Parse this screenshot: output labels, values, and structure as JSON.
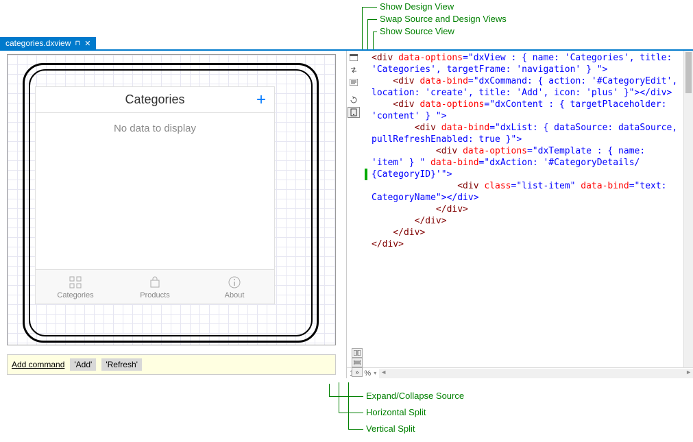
{
  "annotations": {
    "showDesign": "Show Design View",
    "swap": "Swap Source and Design Views",
    "showSource": "Show Source View",
    "expandCollapse": "Expand/Collapse Source",
    "hSplit": "Horizontal Split",
    "vSplit": "Vertical Split"
  },
  "tab": {
    "filename": "categories.dxview",
    "pin": "⊣",
    "close": "✕"
  },
  "designer": {
    "appTitle": "Categories",
    "plus": "+",
    "noData": "No data to display",
    "tabs": {
      "categories": "Categories",
      "products": "Products",
      "about": "About"
    }
  },
  "commandBar": {
    "addCommand": "Add command",
    "btnAdd": "'Add'",
    "btnRefresh": "'Refresh'"
  },
  "zoom": "100 %",
  "source": {
    "l1a": "<div ",
    "l1b": "data-options",
    "l1c": "=\"dxView : { name: 'Categories', title:",
    "l2": "'Categories', targetFrame: 'navigation' } \">",
    "l3a": "    <div ",
    "l3b": "data-bind",
    "l3c": "=\"dxCommand: { action: '#CategoryEdit',",
    "l4": "location: 'create', title: 'Add', icon: 'plus' }\"></div>",
    "l5a": "    <div ",
    "l5b": "data-options",
    "l5c": "=\"dxContent : { targetPlaceholder:",
    "l6": "'content' } \">",
    "l7a": "        <div ",
    "l7b": "data-bind",
    "l7c": "=\"dxList: { dataSource: dataSource,",
    "l8": "pullRefreshEnabled: true }\">",
    "l9a": "            <div ",
    "l9b": "data-options",
    "l9c": "=\"dxTemplate : { name:",
    "l10a": "'item' } \" ",
    "l10b": "data-bind",
    "l10c": "=\"dxAction: '#CategoryDetails/",
    "l11": "{CategoryID}'\">",
    "l12a": "                <div ",
    "l12b": "class",
    "l12c": "=\"list-item\" ",
    "l12d": "data-bind",
    "l12e": "=\"text:",
    "l13": "CategoryName\"></div>",
    "l14": "            </div>",
    "l15": "        </div>",
    "l16": "    </div>",
    "l17": "</div>"
  }
}
